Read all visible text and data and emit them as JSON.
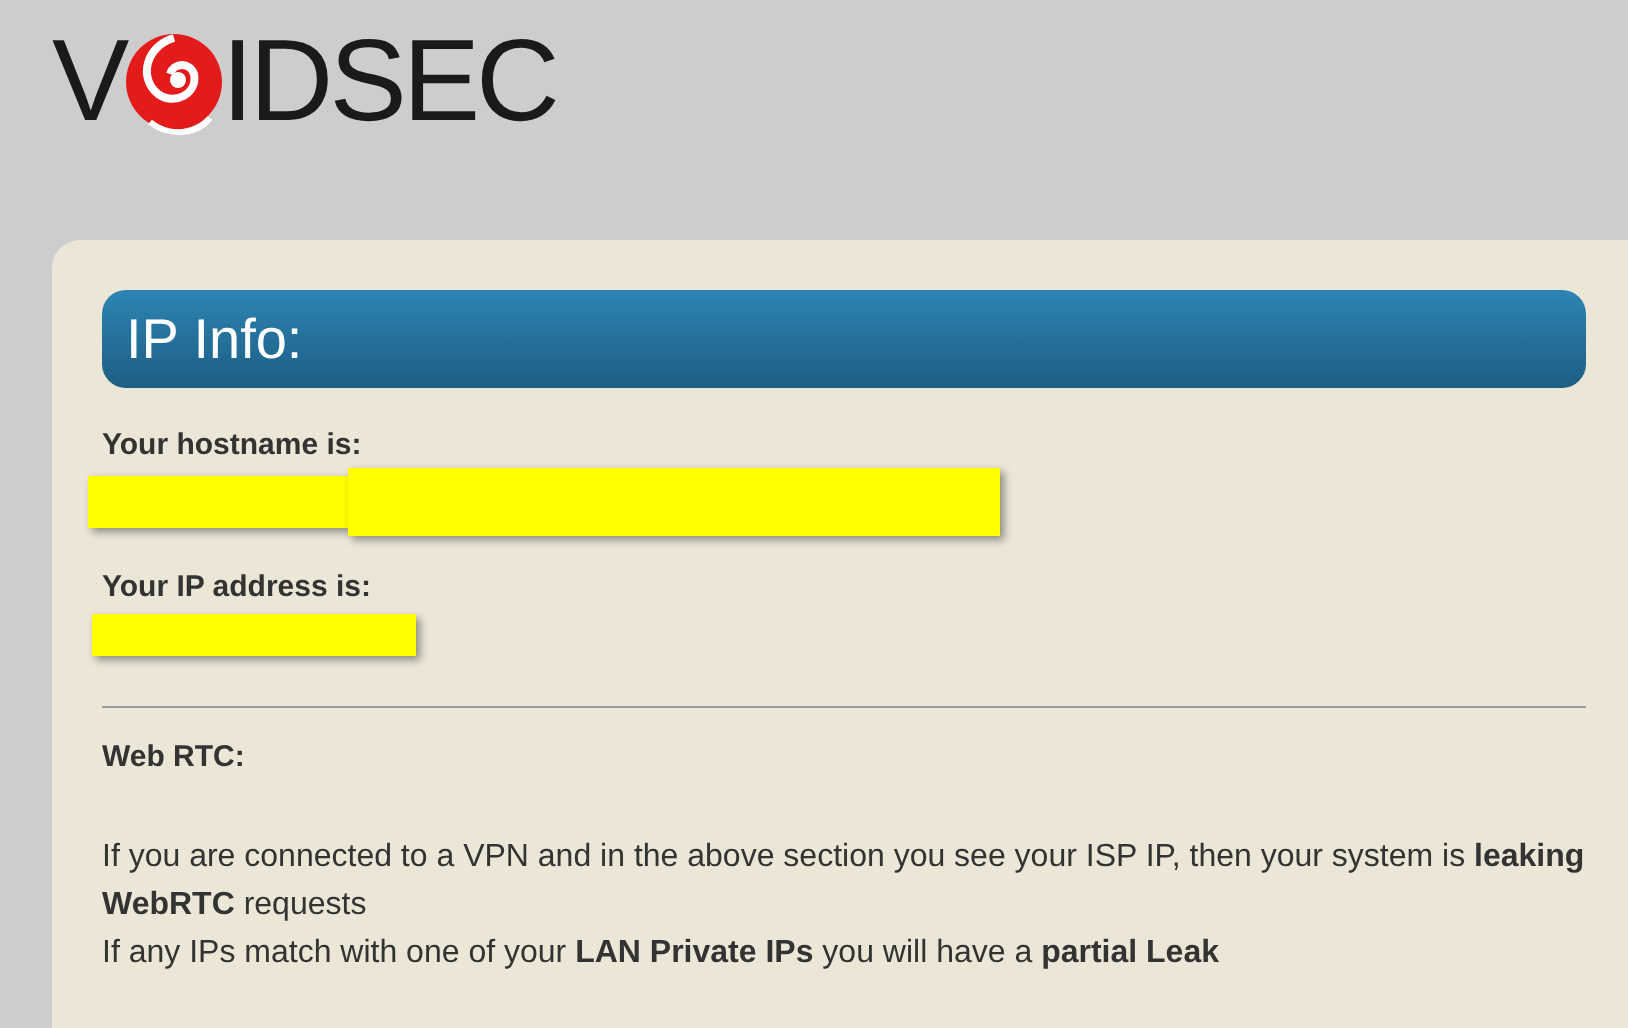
{
  "logo": {
    "before": "V",
    "after": "IDSEC"
  },
  "panel": {
    "title": "IP Info:",
    "fields": [
      {
        "label": "Your hostname is:"
      },
      {
        "label": "Your IP address is:"
      }
    ],
    "section_title": "Web RTC:",
    "paragraphs": [
      "If you are connected to a VPN and in the above section you see your ISP IP, then your system is **leaking WebRTC** requests",
      "If any IPs match with one of your **LAN Private IPs** you will have a **partial Leak**"
    ]
  }
}
